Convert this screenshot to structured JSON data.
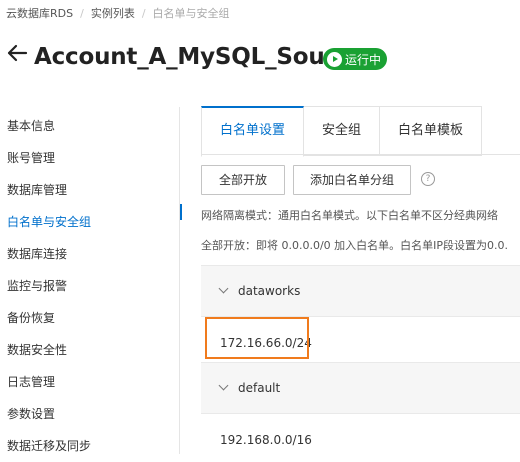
{
  "breadcrumb": [
    "云数据库RDS",
    "实例列表",
    "白名单与安全组"
  ],
  "header": {
    "title": "Account_A_MySQL_Source",
    "status": "运行中"
  },
  "sidebar": {
    "items": [
      {
        "label": "基本信息"
      },
      {
        "label": "账号管理"
      },
      {
        "label": "数据库管理"
      },
      {
        "label": "白名单与安全组"
      },
      {
        "label": "数据库连接"
      },
      {
        "label": "监控与报警"
      },
      {
        "label": "备份恢复"
      },
      {
        "label": "数据安全性"
      },
      {
        "label": "日志管理"
      },
      {
        "label": "参数设置"
      },
      {
        "label": "数据迁移及同步"
      }
    ],
    "active_index": 3
  },
  "tabs": [
    {
      "label": "白名单设置"
    },
    {
      "label": "安全组"
    },
    {
      "label": "白名单模板"
    }
  ],
  "toolbar": {
    "open_all_label": "全部开放",
    "add_group_label": "添加白名单分组",
    "help_icon": "?"
  },
  "notice": {
    "line1": "网络隔离模式：通用白名单模式。以下白名单不区分经典网络",
    "line2": "全部开放：即将 0.0.0.0/0 加入白名单。白名单IP段设置为0.0."
  },
  "groups": [
    {
      "name": "dataworks",
      "ip": "172.16.66.0/24"
    },
    {
      "name": "default",
      "ip": "192.168.0.0/16"
    }
  ],
  "colors": {
    "accent": "#0070cc",
    "status": "#1aa133",
    "highlight": "#f07b1d"
  }
}
